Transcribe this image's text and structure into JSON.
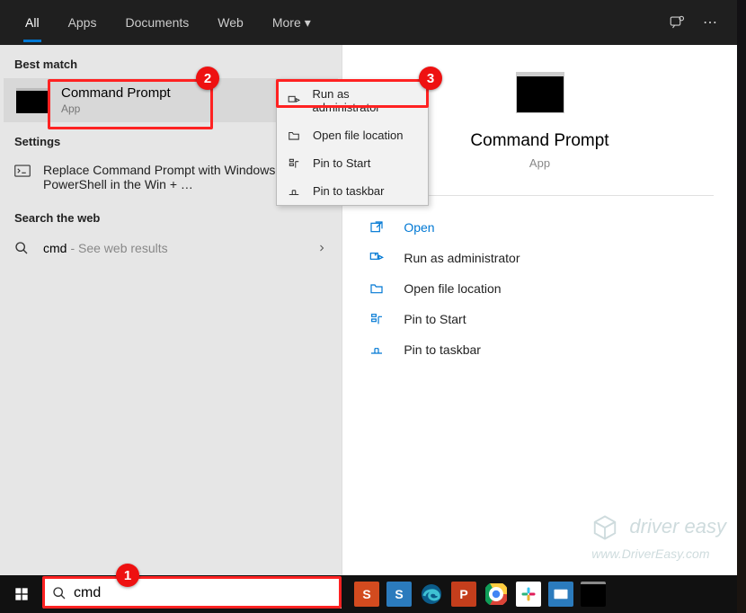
{
  "tabs": {
    "all": "All",
    "apps": "Apps",
    "documents": "Documents",
    "web": "Web",
    "more": "More"
  },
  "sections": {
    "best_match": "Best match",
    "settings": "Settings",
    "search_web": "Search the web"
  },
  "best_match": {
    "title": "Command Prompt",
    "sub": "App"
  },
  "settings_item": "Replace Command Prompt with Windows PowerShell in the Win + …",
  "web": {
    "query": "cmd",
    "hint": " - See web results"
  },
  "context_menu": {
    "run_admin": "Run as administrator",
    "open_loc": "Open file location",
    "pin_start": "Pin to Start",
    "pin_taskbar": "Pin to taskbar"
  },
  "preview": {
    "title": "Command Prompt",
    "sub": "App",
    "open": "Open",
    "run_admin": "Run as administrator",
    "open_loc": "Open file location",
    "pin_start": "Pin to Start",
    "pin_taskbar": "Pin to taskbar"
  },
  "search_input": "cmd",
  "callouts": {
    "c1": "1",
    "c2": "2",
    "c3": "3"
  },
  "watermark": {
    "brand": "driver easy",
    "url": "www.DriverEasy.com"
  },
  "colors": {
    "accent": "#0078d4",
    "callout": "#e11"
  }
}
